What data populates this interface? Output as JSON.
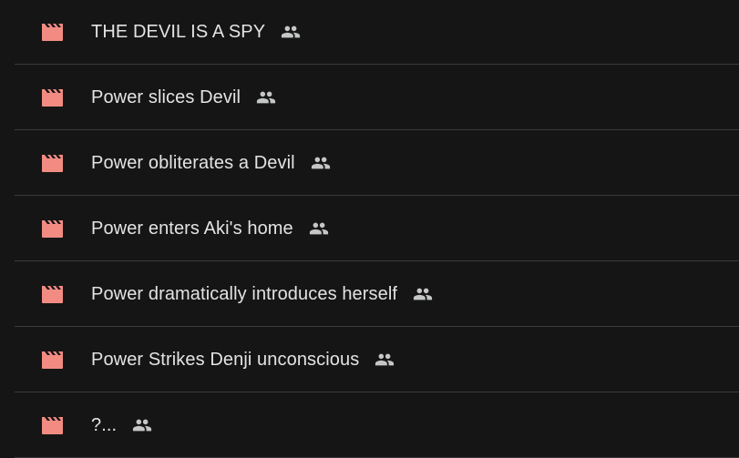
{
  "colors": {
    "background": "#151515",
    "text": "#e3e3e3",
    "divider": "#3a3a3a",
    "video_icon": "#f28b82",
    "shared_icon": "#c4c7c5"
  },
  "files": [
    {
      "name": "THE DEVIL IS A SPY",
      "type_icon": "video-clapperboard-icon",
      "shared": true,
      "shared_icon": "people-icon"
    },
    {
      "name": "Power slices Devil",
      "type_icon": "video-clapperboard-icon",
      "shared": true,
      "shared_icon": "people-icon"
    },
    {
      "name": "Power obliterates a Devil",
      "type_icon": "video-clapperboard-icon",
      "shared": true,
      "shared_icon": "people-icon"
    },
    {
      "name": "Power enters Aki's home",
      "type_icon": "video-clapperboard-icon",
      "shared": true,
      "shared_icon": "people-icon"
    },
    {
      "name": "Power dramatically introduces herself",
      "type_icon": "video-clapperboard-icon",
      "shared": true,
      "shared_icon": "people-icon"
    },
    {
      "name": "Power Strikes Denji unconscious",
      "type_icon": "video-clapperboard-icon",
      "shared": true,
      "shared_icon": "people-icon"
    },
    {
      "name": "?...",
      "type_icon": "video-clapperboard-icon",
      "shared": true,
      "shared_icon": "people-icon"
    }
  ]
}
